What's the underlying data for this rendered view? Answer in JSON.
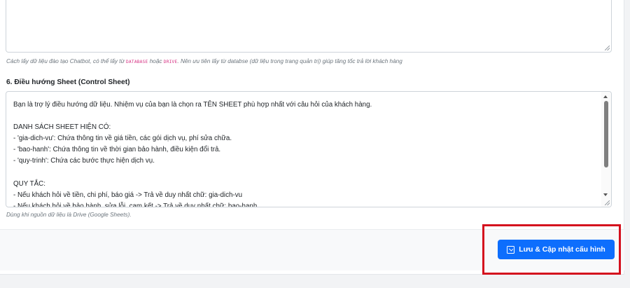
{
  "help_text_1": {
    "before": "Cách lấy dữ liệu đào tạo Chatbot, có thể lấy từ ",
    "code_1": "DATABASE",
    "middle": " hoặc ",
    "code_2": "DRIVE",
    "after": ". Nên ưu tiên lấy từ databse (dữ liệu trong trang quản trị) giúp tăng tốc trả lời khách hàng"
  },
  "section": {
    "label": "6. Điều hướng Sheet (Control Sheet)"
  },
  "prompt": {
    "value": "Bạn là trợ lý điều hướng dữ liệu. Nhiệm vụ của bạn là chọn ra TÊN SHEET phù hợp nhất với câu hỏi của khách hàng.\n\nDANH SÁCH SHEET HIỆN CÓ:\n- 'gia-dich-vu': Chứa thông tin về giá tiền, các gói dịch vụ, phí sửa chữa.\n- 'bao-hanh': Chứa thông tin về thời gian bảo hành, điều kiện đổi trả.\n- 'quy-trinh': Chứa các bước thực hiện dịch vụ.\n\nQUY TẮC:\n- Nếu khách hỏi về tiền, chi phí, báo giá -> Trả về duy nhất chữ: gia-dich-vu\n- Nếu khách hỏi về bảo hành, sửa lỗi, cam kết -> Trả về duy nhất chữ: bao-hanh",
    "help": "Dùng khi nguồn dữ liệu là Drive (Google Sheets)."
  },
  "footer": {
    "save_label": "Lưu & Cập nhật cấu hình",
    "save_icon": "save-icon"
  },
  "colors": {
    "primary": "#0d6efd",
    "highlight": "#d4101e",
    "code": "#d63384"
  }
}
